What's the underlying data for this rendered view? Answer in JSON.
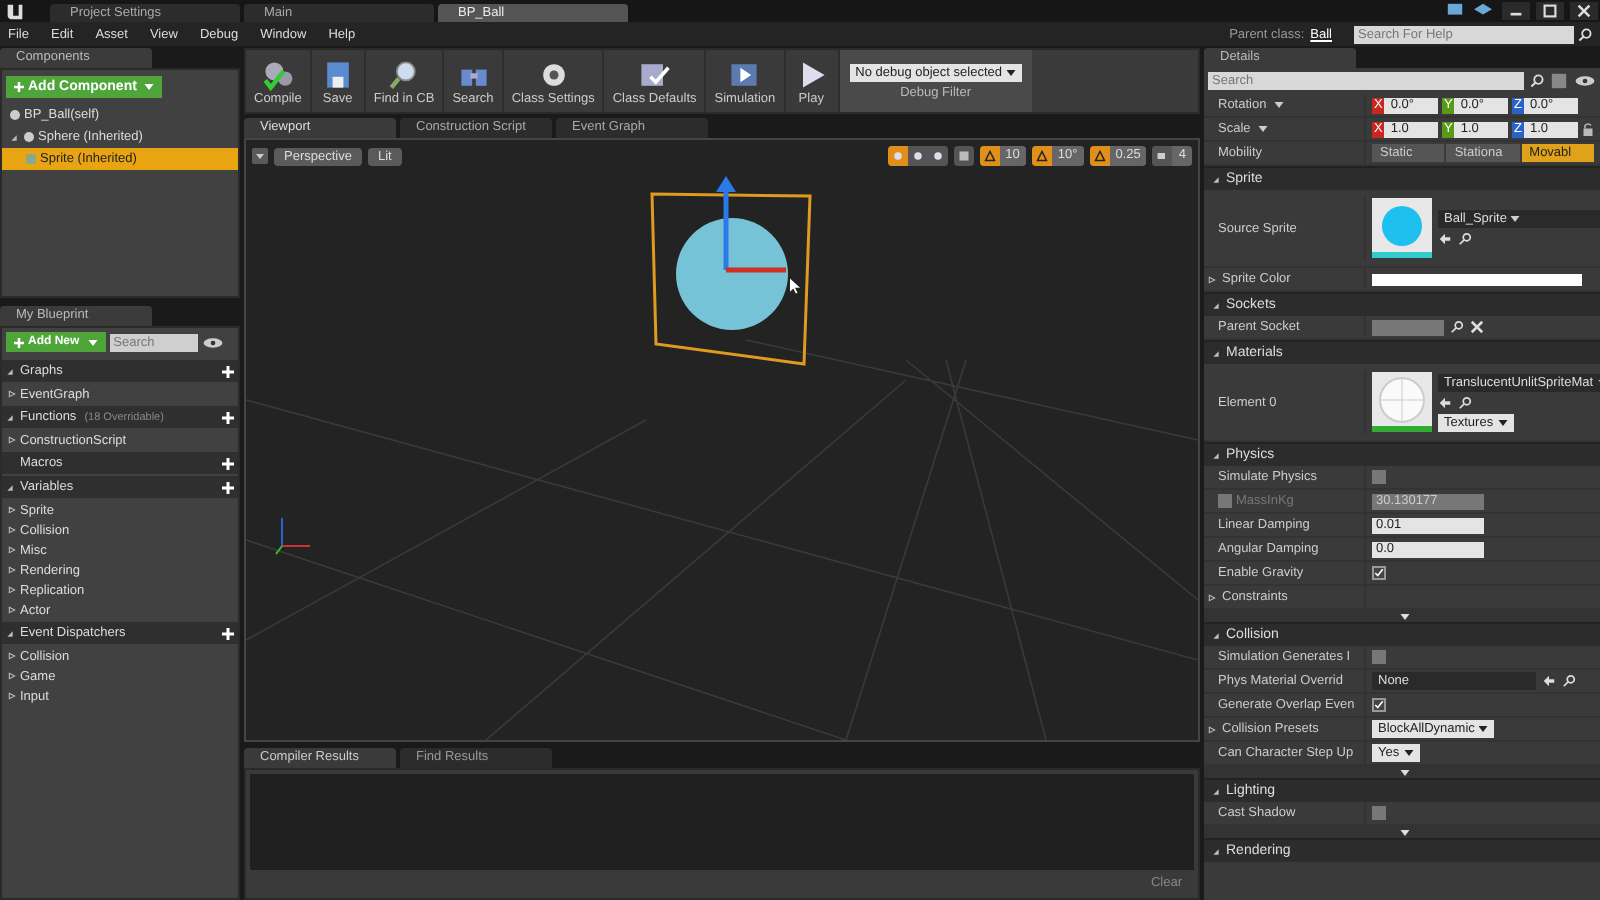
{
  "title_tabs": [
    {
      "label": "Project Settings",
      "selected": false
    },
    {
      "label": "Main",
      "selected": false
    },
    {
      "label": "BP_Ball",
      "selected": true
    }
  ],
  "menu": [
    "File",
    "Edit",
    "Asset",
    "View",
    "Debug",
    "Window",
    "Help"
  ],
  "parent_class": {
    "label": "Parent class:",
    "value": "Ball"
  },
  "help_search": {
    "placeholder": "Search For Help"
  },
  "components": {
    "tab": "Components",
    "add_button": "Add Component",
    "tree": [
      {
        "label": "BP_Ball(self)",
        "selected": false,
        "expanded": false
      },
      {
        "label": "Sphere (Inherited)",
        "selected": false,
        "expanded": true,
        "children": [
          {
            "label": "Sprite (Inherited)",
            "selected": true
          }
        ]
      }
    ]
  },
  "my_blueprint": {
    "tab": "My Blueprint",
    "add_button": "Add New",
    "search": {
      "placeholder": "Search"
    },
    "sections": [
      {
        "title": "Graphs",
        "expanded": true,
        "items": [
          "EventGraph"
        ]
      },
      {
        "title": "Functions",
        "note": "(18 Overridable)",
        "expanded": true,
        "items": [
          "ConstructionScript"
        ]
      },
      {
        "title": "Macros",
        "expanded": false
      },
      {
        "title": "Variables",
        "expanded": true,
        "items": [
          "Sprite",
          "Collision",
          "Misc",
          "Rendering",
          "Replication",
          "Actor"
        ]
      },
      {
        "title": "Event Dispatchers",
        "expanded": true,
        "items": [
          "Collision",
          "Game",
          "Input"
        ]
      }
    ]
  },
  "toolbar": [
    {
      "label": "Compile"
    },
    {
      "label": "Save"
    },
    {
      "label": "Find in CB"
    },
    {
      "label": "Search"
    },
    {
      "label": "Class Settings"
    },
    {
      "label": "Class Defaults"
    },
    {
      "label": "Simulation"
    },
    {
      "label": "Play"
    }
  ],
  "debug_filter": {
    "value": "No debug object selected",
    "label": "Debug Filter"
  },
  "editor_tabs": [
    {
      "label": "Viewport",
      "selected": true
    },
    {
      "label": "Construction Script",
      "selected": false
    },
    {
      "label": "Event Graph",
      "selected": false
    }
  ],
  "viewport": {
    "view_mode": "Perspective",
    "lighting": "Lit",
    "transform_tools": [
      {
        "selected": true
      },
      {
        "selected": false
      },
      {
        "selected": false
      }
    ],
    "snaps": [
      {
        "value": "10",
        "on": true
      },
      {
        "value": "10°",
        "on": true
      },
      {
        "value": "0.25",
        "on": true
      }
    ],
    "camera_speed": "4"
  },
  "results_tabs": [
    {
      "label": "Compiler Results",
      "selected": true
    },
    {
      "label": "Find Results",
      "selected": false
    }
  ],
  "clear_button": "Clear",
  "details": {
    "tab": "Details",
    "search": {
      "placeholder": "Search"
    },
    "vectors": [
      {
        "label": "Rotation",
        "values": [
          {
            "axis": "X",
            "value": "0.0°"
          },
          {
            "axis": "Y",
            "value": "0.0°"
          },
          {
            "axis": "Z",
            "value": "0.0°"
          }
        ],
        "locked": false
      },
      {
        "label": "Scale",
        "values": [
          {
            "axis": "X",
            "value": "1.0"
          },
          {
            "axis": "Y",
            "value": "1.0"
          },
          {
            "axis": "Z",
            "value": "1.0"
          }
        ],
        "locked": true
      }
    ],
    "mobility": {
      "label": "Mobility",
      "options": [
        {
          "label": "Static",
          "selected": false
        },
        {
          "label": "Stationa",
          "selected": false
        },
        {
          "label": "Movabl",
          "selected": true
        }
      ]
    },
    "sections": [
      {
        "title": "Sprite",
        "rows": [
          {
            "kind": "sprite-asset",
            "label": "Source Sprite",
            "value": "Ball_Sprite",
            "expandable": false
          },
          {
            "kind": "color",
            "label": "Sprite Color",
            "expandable": true
          }
        ]
      },
      {
        "title": "Sockets",
        "rows": [
          {
            "kind": "socket",
            "label": "Parent Socket",
            "expandable": false
          }
        ]
      },
      {
        "title": "Materials",
        "rows": [
          {
            "kind": "material-asset",
            "label": "Element 0",
            "value": "TranslucentUnlitSpriteMat",
            "extra": "Textures",
            "expandable": false
          }
        ]
      },
      {
        "title": "Physics",
        "rows": [
          {
            "kind": "checkbox",
            "label": "Simulate Physics",
            "checked": false,
            "expandable": false
          },
          {
            "kind": "check-number",
            "label": "MassInKg",
            "checked": false,
            "disabled": true,
            "value": "30.130177",
            "expandable": false
          },
          {
            "kind": "number",
            "label": "Linear Damping",
            "value": "0.01",
            "expandable": false
          },
          {
            "kind": "number",
            "label": "Angular Damping",
            "value": "0.0",
            "expandable": false
          },
          {
            "kind": "checkbox",
            "label": "Enable Gravity",
            "checked": true,
            "expandable": false
          },
          {
            "kind": "group",
            "label": "Constraints",
            "expandable": true
          },
          {
            "kind": "advanced-toggle"
          }
        ]
      },
      {
        "title": "Collision",
        "rows": [
          {
            "kind": "checkbox",
            "label": "Simulation Generates I",
            "checked": false,
            "expandable": false
          },
          {
            "kind": "asset-dropdown",
            "label": "Phys Material Overrid",
            "value": "None",
            "expandable": false
          },
          {
            "kind": "checkbox",
            "label": "Generate Overlap Even",
            "checked": true,
            "expandable": false
          },
          {
            "kind": "dropdown",
            "label": "Collision Presets",
            "value": "BlockAllDynamic",
            "expandable": true
          },
          {
            "kind": "dropdown",
            "label": "Can Character Step Up",
            "value": "Yes",
            "expandable": false
          },
          {
            "kind": "advanced-toggle"
          }
        ]
      },
      {
        "title": "Lighting",
        "rows": [
          {
            "kind": "checkbox",
            "label": "Cast Shadow",
            "checked": false,
            "expandable": false
          },
          {
            "kind": "advanced-toggle"
          }
        ]
      },
      {
        "title": "Rendering"
      }
    ]
  }
}
